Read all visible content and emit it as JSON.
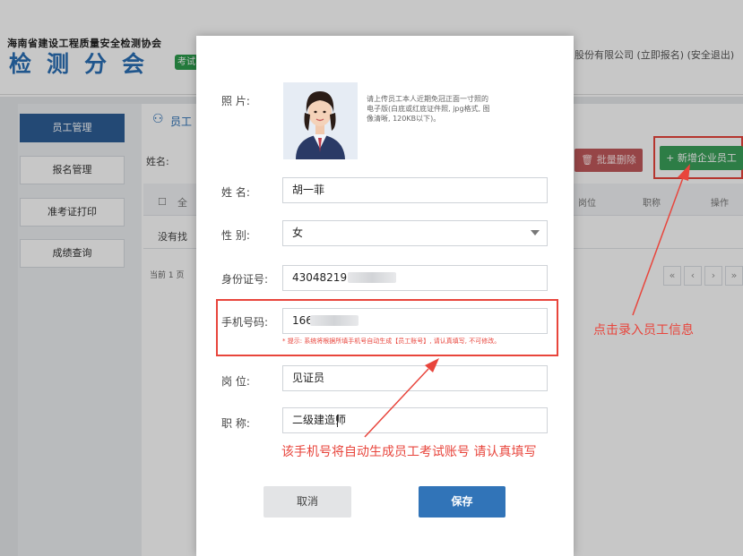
{
  "header": {
    "org_name": "海南省建设工程质量安全检测协会",
    "logo_text": "检测分会",
    "logo_badge": "考试",
    "user_info": "股份有限公司 (立即报名) (安全退出)"
  },
  "sidebar": {
    "items": [
      {
        "label": "员工管理",
        "active": true
      },
      {
        "label": "报名管理",
        "active": false
      },
      {
        "label": "准考证打印",
        "active": false
      },
      {
        "label": "成绩查询",
        "active": false
      }
    ]
  },
  "main": {
    "section_title": "员工",
    "search_label": "姓名:",
    "batch_delete": "批量删除",
    "add_employee": "+ 新增企业员工",
    "table_headers": {
      "select_all": "全",
      "position": "岗位",
      "title": "职称",
      "action": "操作"
    },
    "empty_text": "没有找",
    "pager_text": "当前 1 页",
    "pager_buttons": [
      "«",
      "‹",
      "›",
      "»"
    ]
  },
  "modal": {
    "photo_label": "照    片:",
    "photo_note": "请上传员工本人近期免冠正面一寸照的电子版(白底或红底证件照, jpg格式, 图像清晰, 120KB以下)。",
    "name_label": "姓    名:",
    "name_value": "胡一菲",
    "gender_label": "性    别:",
    "gender_value": "女",
    "id_label": "身份证号:",
    "id_value": "43048219",
    "phone_label": "手机号码:",
    "phone_value": "166",
    "phone_hint": "* 提示: 系统将根据所填手机号自动生成【员工账号】, 请认真填写, 不可修改。",
    "position_label": "岗    位:",
    "position_value": "见证员",
    "title_label": "职    称:",
    "title_value": "二级建造师",
    "cancel_label": "取消",
    "save_label": "保存"
  },
  "annotations": {
    "right_note": "点击录入员工信息",
    "bottom_note": "该手机号将自动生成员工考试账号 请认真填写"
  },
  "colors": {
    "brand_blue": "#2a6fb5",
    "sidebar_active": "#2d5e96",
    "add_button": "#3aa15a",
    "delete_button": "#c0595c",
    "save_button": "#3174b8",
    "annotation_red": "#e8453c"
  }
}
